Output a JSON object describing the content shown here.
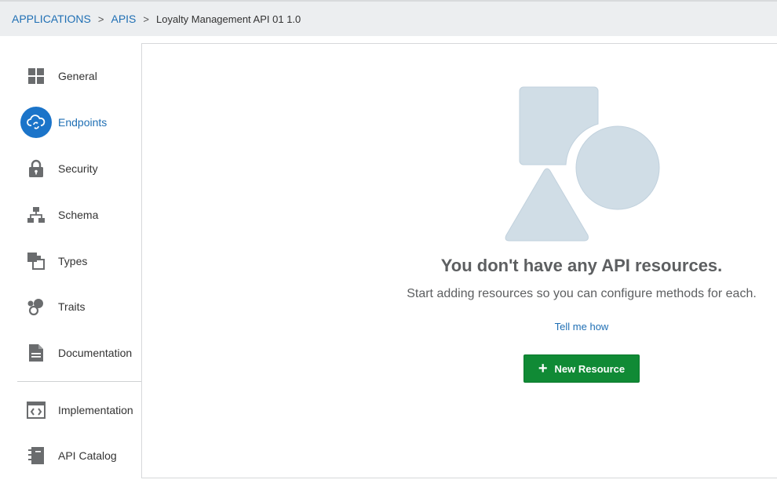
{
  "breadcrumb": {
    "items": [
      "APPLICATIONS",
      "APIS"
    ],
    "separator": ">",
    "current": "Loyalty Management API 01  1.0"
  },
  "sidebar": {
    "items": [
      {
        "label": "General",
        "icon": "grid-icon"
      },
      {
        "label": "Endpoints",
        "icon": "cloud-sync-icon",
        "active": true
      },
      {
        "label": "Security",
        "icon": "lock-icon"
      },
      {
        "label": "Schema",
        "icon": "hierarchy-icon"
      },
      {
        "label": "Types",
        "icon": "types-icon"
      },
      {
        "label": "Traits",
        "icon": "traits-icon"
      },
      {
        "label": "Documentation",
        "icon": "document-icon"
      },
      {
        "label": "Implementation",
        "icon": "code-icon"
      },
      {
        "label": "API Catalog",
        "icon": "catalog-icon"
      }
    ]
  },
  "empty_state": {
    "title": "You don't have any API resources.",
    "subtitle": "Start adding resources so you can configure methods for each.",
    "help_link": "Tell me how",
    "button_label": "New Resource",
    "button_icon": "plus-icon"
  },
  "colors": {
    "accent": "#1b74c9",
    "link": "#1f6fb4",
    "button": "#108a35",
    "illustration": "#d0dde6"
  }
}
